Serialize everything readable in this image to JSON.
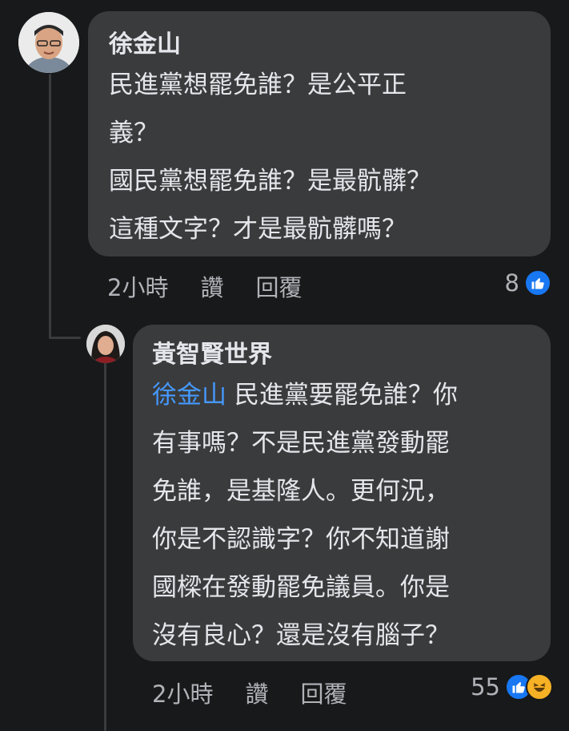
{
  "colors": {
    "background": "#18191a",
    "bubble": "#3a3b3c",
    "text": "#e4e6eb",
    "meta": "#b0b3b8",
    "mention": "#4599ff",
    "like": "#1877f2"
  },
  "comment": {
    "author": "徐金山",
    "lines": [
      "民進黨想罷免誰？是公平正",
      "義？",
      "國民黨想罷免誰？是最骯髒？",
      "這種文字？才是最骯髒嗎？"
    ],
    "time": "2小時",
    "like_label": "讚",
    "reply_label": "回覆",
    "reaction_count": "8",
    "reaction_icons": [
      "like-icon"
    ]
  },
  "reply": {
    "author": "黃智賢世界",
    "mention": "徐金山",
    "first_line_rest": " 民進黨要罷免誰？你",
    "lines": [
      "有事嗎？不是民進黨發動罷",
      "免誰，是基隆人。更何況，",
      "你是不認識字？你不知道謝",
      "國樑在發動罷免議員。你是",
      "沒有良心？還是沒有腦子？"
    ],
    "time": "2小時",
    "like_label": "讚",
    "reply_label": "回覆",
    "reaction_count": "55",
    "reaction_icons": [
      "like-icon",
      "haha-icon"
    ]
  }
}
